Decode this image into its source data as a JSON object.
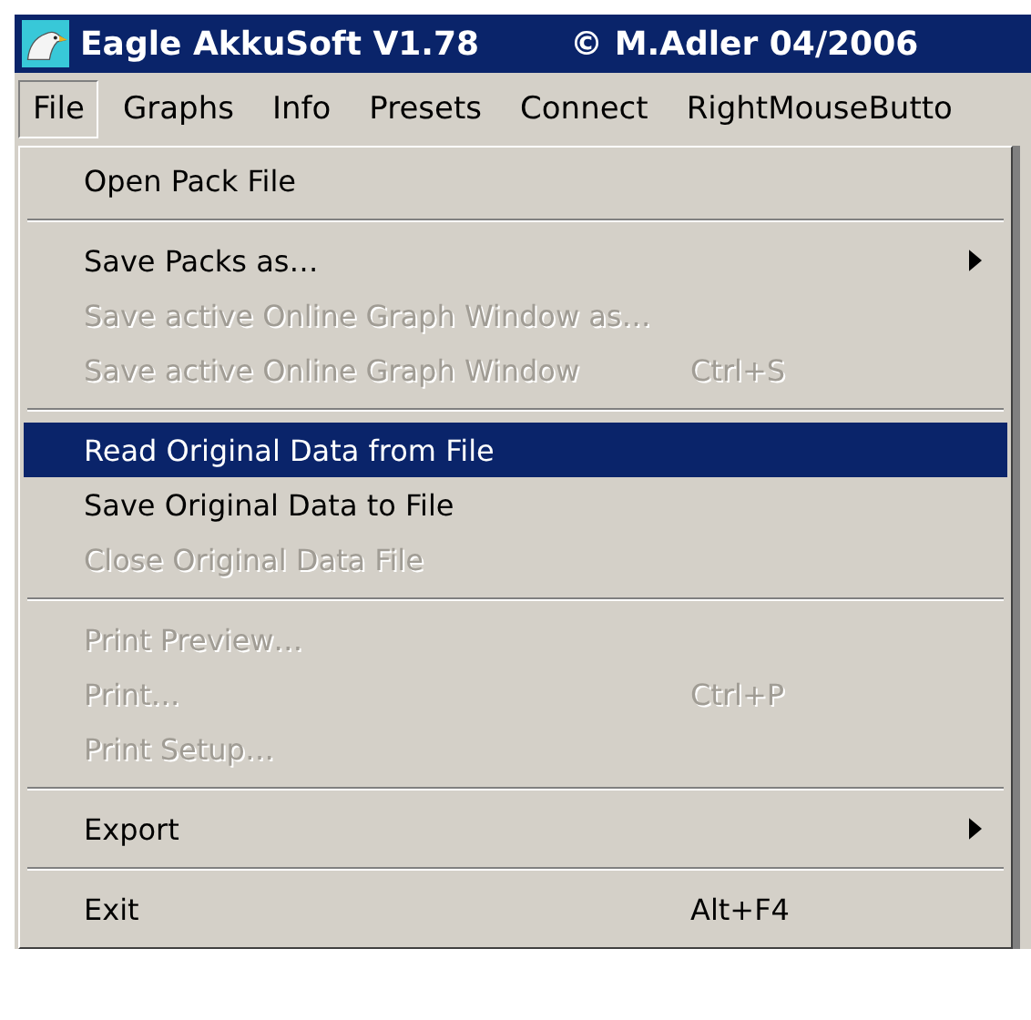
{
  "window": {
    "title": "Eagle AkkuSoft V1.78",
    "copyright": "© M.Adler 04/2006"
  },
  "menubar": [
    {
      "label": "File",
      "selected": true
    },
    {
      "label": "Graphs",
      "selected": false
    },
    {
      "label": "Info",
      "selected": false
    },
    {
      "label": "Presets",
      "selected": false
    },
    {
      "label": "Connect",
      "selected": false
    },
    {
      "label": "RightMouseButto",
      "selected": false
    }
  ],
  "file_menu": [
    {
      "kind": "item",
      "label": "Open Pack File",
      "disabled": false,
      "selected": false,
      "submenu": false
    },
    {
      "kind": "separator"
    },
    {
      "kind": "item",
      "label": "Save Packs as…",
      "disabled": false,
      "selected": false,
      "submenu": true
    },
    {
      "kind": "item",
      "label": "Save active Online Graph Window as…",
      "disabled": true,
      "selected": false,
      "submenu": false
    },
    {
      "kind": "item",
      "label": "Save active Online Graph Window",
      "shortcut": "Ctrl+S",
      "disabled": true,
      "selected": false,
      "submenu": false
    },
    {
      "kind": "separator"
    },
    {
      "kind": "item",
      "label": "Read Original Data from File",
      "disabled": false,
      "selected": true,
      "submenu": false
    },
    {
      "kind": "item",
      "label": "Save Original Data to File",
      "disabled": false,
      "selected": false,
      "submenu": false
    },
    {
      "kind": "item",
      "label": "Close Original Data File",
      "disabled": true,
      "selected": false,
      "submenu": false
    },
    {
      "kind": "separator"
    },
    {
      "kind": "item",
      "label": "Print Preview…",
      "disabled": true,
      "selected": false,
      "submenu": false
    },
    {
      "kind": "item",
      "label": "Print…",
      "shortcut": "Ctrl+P",
      "disabled": true,
      "selected": false,
      "submenu": false
    },
    {
      "kind": "item",
      "label": "Print Setup…",
      "disabled": true,
      "selected": false,
      "submenu": false
    },
    {
      "kind": "separator"
    },
    {
      "kind": "item",
      "label": "Export",
      "disabled": false,
      "selected": false,
      "submenu": true
    },
    {
      "kind": "separator"
    },
    {
      "kind": "item",
      "label": "Exit",
      "shortcut": "Alt+F4",
      "disabled": false,
      "selected": false,
      "submenu": false
    }
  ]
}
